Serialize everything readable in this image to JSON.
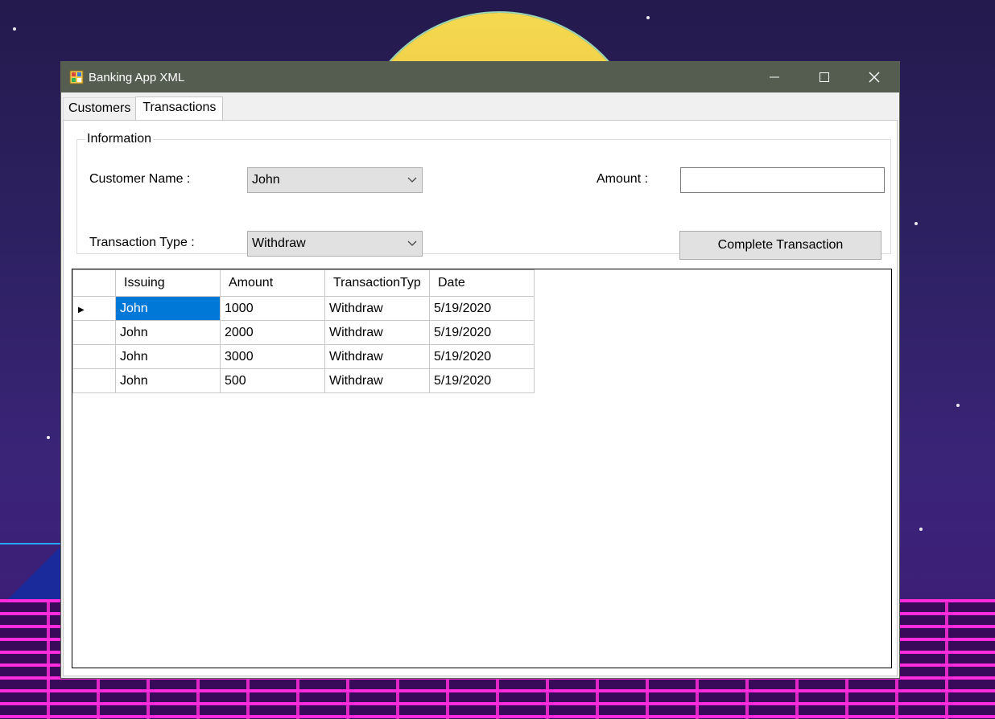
{
  "window": {
    "title": "Banking App XML"
  },
  "titlebar_buttons": {
    "minimize": "—",
    "maximize": "☐",
    "close": "✕"
  },
  "tabs": [
    {
      "label": "Customers"
    },
    {
      "label": "Transactions"
    }
  ],
  "info": {
    "legend": "Information",
    "customer_name_label": "Customer Name :",
    "customer_name_value": "John",
    "transaction_type_label": "Transaction Type :",
    "transaction_type_value": "Withdraw",
    "amount_label": "Amount :",
    "amount_value": "",
    "complete_button": "Complete Transaction"
  },
  "grid": {
    "columns": [
      "Issuing",
      "Amount",
      "TransactionTyp",
      "Date"
    ],
    "rows": [
      [
        "John",
        "1000",
        "Withdraw",
        "5/19/2020"
      ],
      [
        "John",
        "2000",
        "Withdraw",
        "5/19/2020"
      ],
      [
        "John",
        "3000",
        "Withdraw",
        "5/19/2020"
      ],
      [
        "John",
        "500",
        "Withdraw",
        "5/19/2020"
      ]
    ],
    "current_row_marker": "▶"
  },
  "colors": {
    "titlebar": "#555c50",
    "selection": "#0078d7"
  }
}
